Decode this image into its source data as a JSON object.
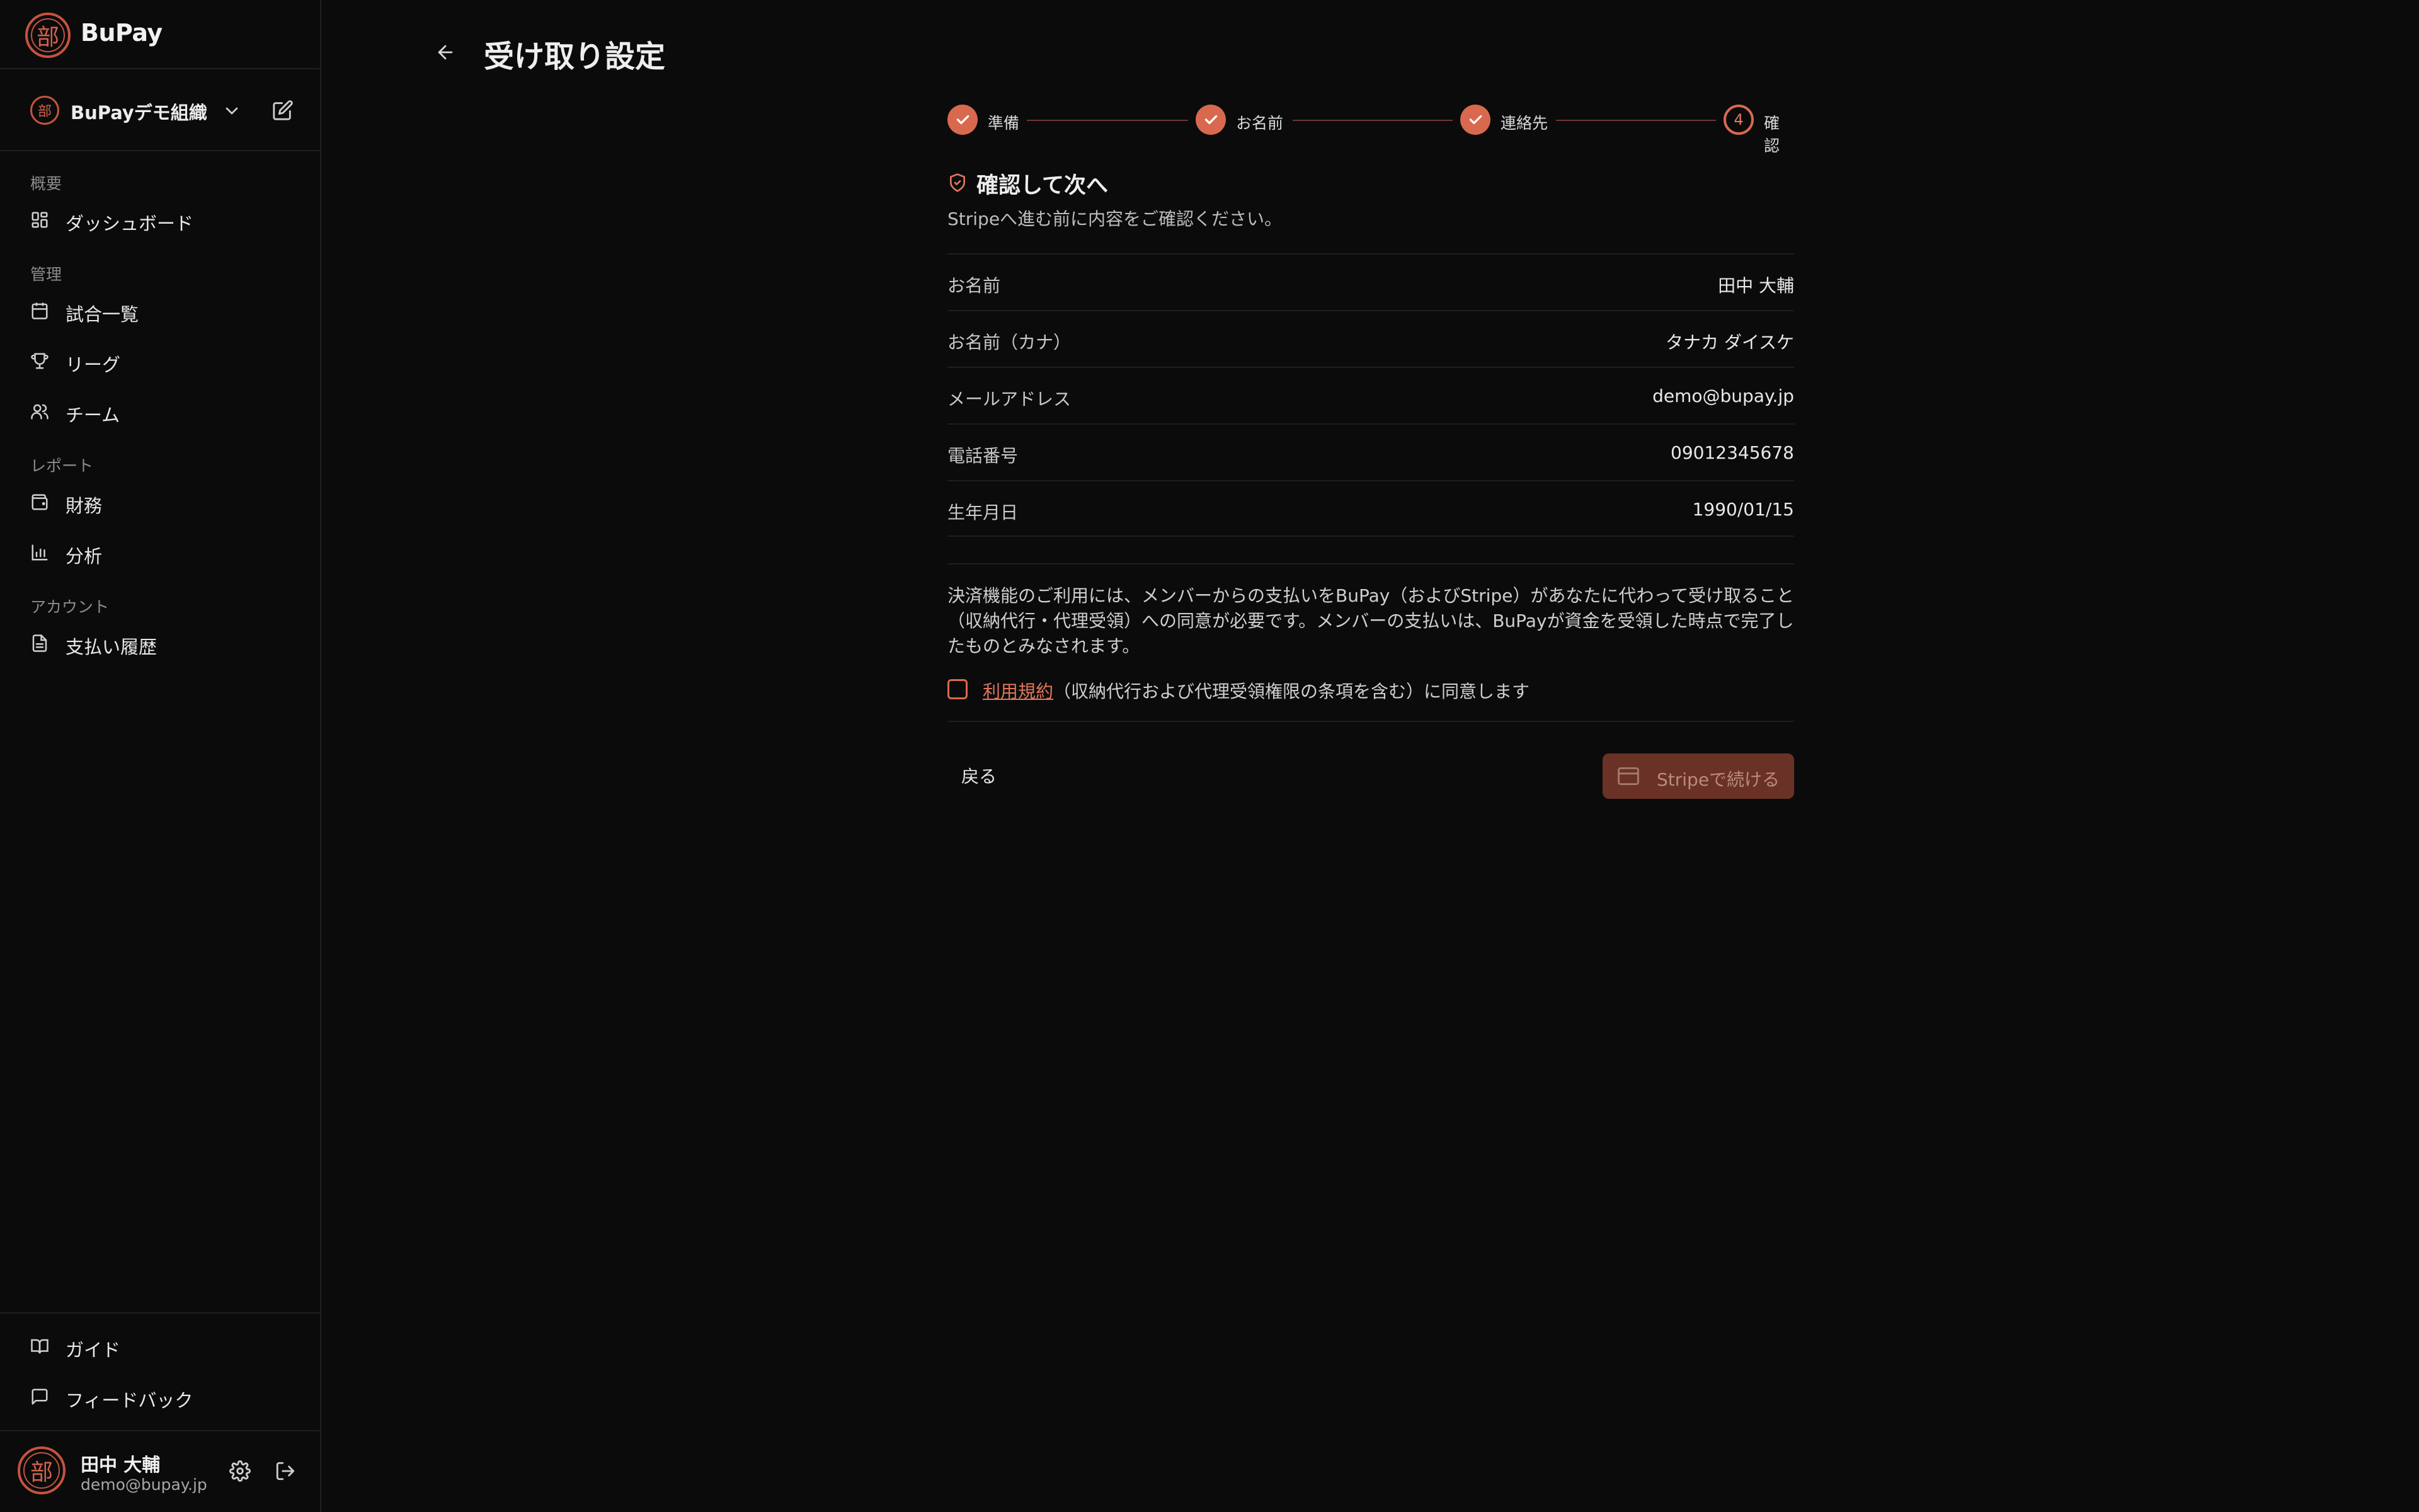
{
  "brand": {
    "name": "BuPay",
    "logo_glyph": "部"
  },
  "org": {
    "name": "BuPayデモ組織",
    "avatar_glyph": "部"
  },
  "sidebar": {
    "sections": [
      {
        "label": "概要"
      },
      {
        "label": "管理"
      },
      {
        "label": "レポート"
      },
      {
        "label": "アカウント"
      }
    ],
    "items": [
      {
        "label": "ダッシュボード",
        "icon": "grid-icon"
      },
      {
        "label": "試合一覧",
        "icon": "calendar-icon"
      },
      {
        "label": "リーグ",
        "icon": "trophy-icon"
      },
      {
        "label": "チーム",
        "icon": "users-icon"
      },
      {
        "label": "財務",
        "icon": "wallet-icon"
      },
      {
        "label": "分析",
        "icon": "bar-chart-icon"
      },
      {
        "label": "支払い履歴",
        "icon": "document-icon"
      }
    ],
    "bottom_items": [
      {
        "label": "ガイド",
        "icon": "book-icon"
      },
      {
        "label": "フィードバック",
        "icon": "message-icon"
      }
    ]
  },
  "user": {
    "name": "田中 大輔",
    "email": "demo@bupay.jp",
    "avatar_glyph": "部"
  },
  "page": {
    "title": "受け取り設定"
  },
  "stepper": {
    "steps": [
      {
        "label": "準備",
        "status": "done"
      },
      {
        "label": "お名前",
        "status": "done"
      },
      {
        "label": "連絡先",
        "status": "done"
      },
      {
        "label": "確認",
        "status": "current",
        "number": "4"
      }
    ]
  },
  "confirm": {
    "title": "確認して次へ",
    "description": "Stripeへ進む前に内容をご確認ください。",
    "rows": [
      {
        "key": "お名前",
        "value": "田中 大輔"
      },
      {
        "key": "お名前（カナ）",
        "value": "タナカ ダイスケ"
      },
      {
        "key": "メールアドレス",
        "value": "demo@bupay.jp"
      },
      {
        "key": "電話番号",
        "value": "09012345678"
      },
      {
        "key": "生年月日",
        "value": "1990/01/15"
      }
    ],
    "consent_text": "決済機能のご利用には、メンバーからの支払いをBuPay（およびStripe）があなたに代わって受け取ること（収納代行・代理受領）への同意が必要です。メンバーの支払いは、BuPayが資金を受領した時点で完了したものとみなされます。",
    "agree_link": "利用規約",
    "agree_rest": "（収納代行および代理受領権限の条項を含む）に同意します"
  },
  "actions": {
    "back_label": "戻る",
    "continue_label": "Stripeで続ける"
  },
  "colors": {
    "accent": "#d8694f",
    "background": "#0b0b0b",
    "button_disabled": "#6a3226"
  }
}
